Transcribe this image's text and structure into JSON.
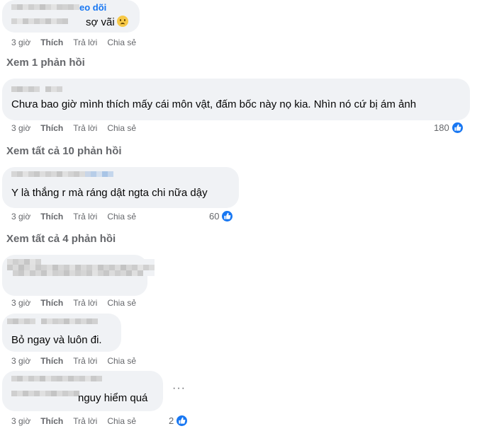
{
  "colors": {
    "bubble": "#f0f2f5",
    "meta": "#65676b",
    "link": "#1877f2",
    "like": "#1877f2"
  },
  "actions": {
    "time": "3 giờ",
    "like": "Thích",
    "reply": "Trả lời",
    "share": "Chia sẻ"
  },
  "comments": [
    {
      "name_fragment": "eo dõi",
      "text": "sợ vãi",
      "emoji": "worried-face-emoji"
    },
    {
      "text": "Chưa bao giờ mình thích mấy cái môn vật, đấm bốc này nọ kia. Nhìn nó cứ bị ám ảnh",
      "likes": "180"
    },
    {
      "text": "Y là thắng r mà ráng dật ngta chi nữa dậy",
      "likes": "60"
    },
    {
      "text": ""
    },
    {
      "text": "Bỏ ngay và luôn đi."
    },
    {
      "text": "nguy hiểm quá",
      "likes": "2"
    }
  ],
  "replies": {
    "r1": "Xem 1 phản hồi",
    "r2": "Xem tất cả 10 phản hồi",
    "r3": "Xem tất cả 4 phản hồi"
  },
  "more_label": "···"
}
